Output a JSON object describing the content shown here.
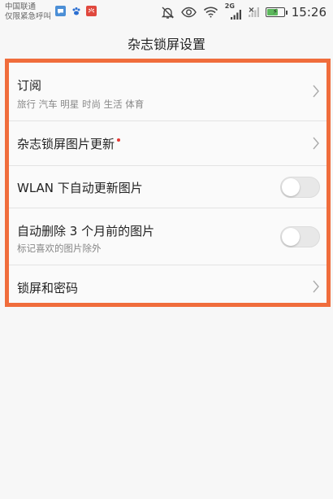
{
  "status_bar": {
    "carrier_line1": "中国联通",
    "carrier_line2": "仅限紧急呼叫",
    "signal_label": "2G",
    "time": "15:26",
    "battery_level": 0.7,
    "notification_icons": [
      "chat-icon",
      "paw-icon",
      "huawei-icon"
    ],
    "system_icons": [
      "mute-icon",
      "eye-icon",
      "wifi-icon",
      "signal-icon",
      "no-signal-icon",
      "battery-charging-icon"
    ]
  },
  "header": {
    "title": "杂志锁屏设置"
  },
  "settings": {
    "subscribe": {
      "title": "订阅",
      "subtitle": "旅行 汽车 明星 时尚 生活 体育"
    },
    "magazine_update": {
      "title": "杂志锁屏图片更新"
    },
    "wlan_update": {
      "title": "WLAN 下自动更新图片",
      "enabled": false
    },
    "auto_delete": {
      "title": "自动删除 3 个月前的图片",
      "subtitle": "标记喜欢的图片除外",
      "enabled": false
    },
    "lock_password": {
      "title": "锁屏和密码"
    }
  },
  "colors": {
    "highlight_frame": "#f06d3c",
    "new_dot": "#e53935",
    "background": "#f7f7f7"
  }
}
